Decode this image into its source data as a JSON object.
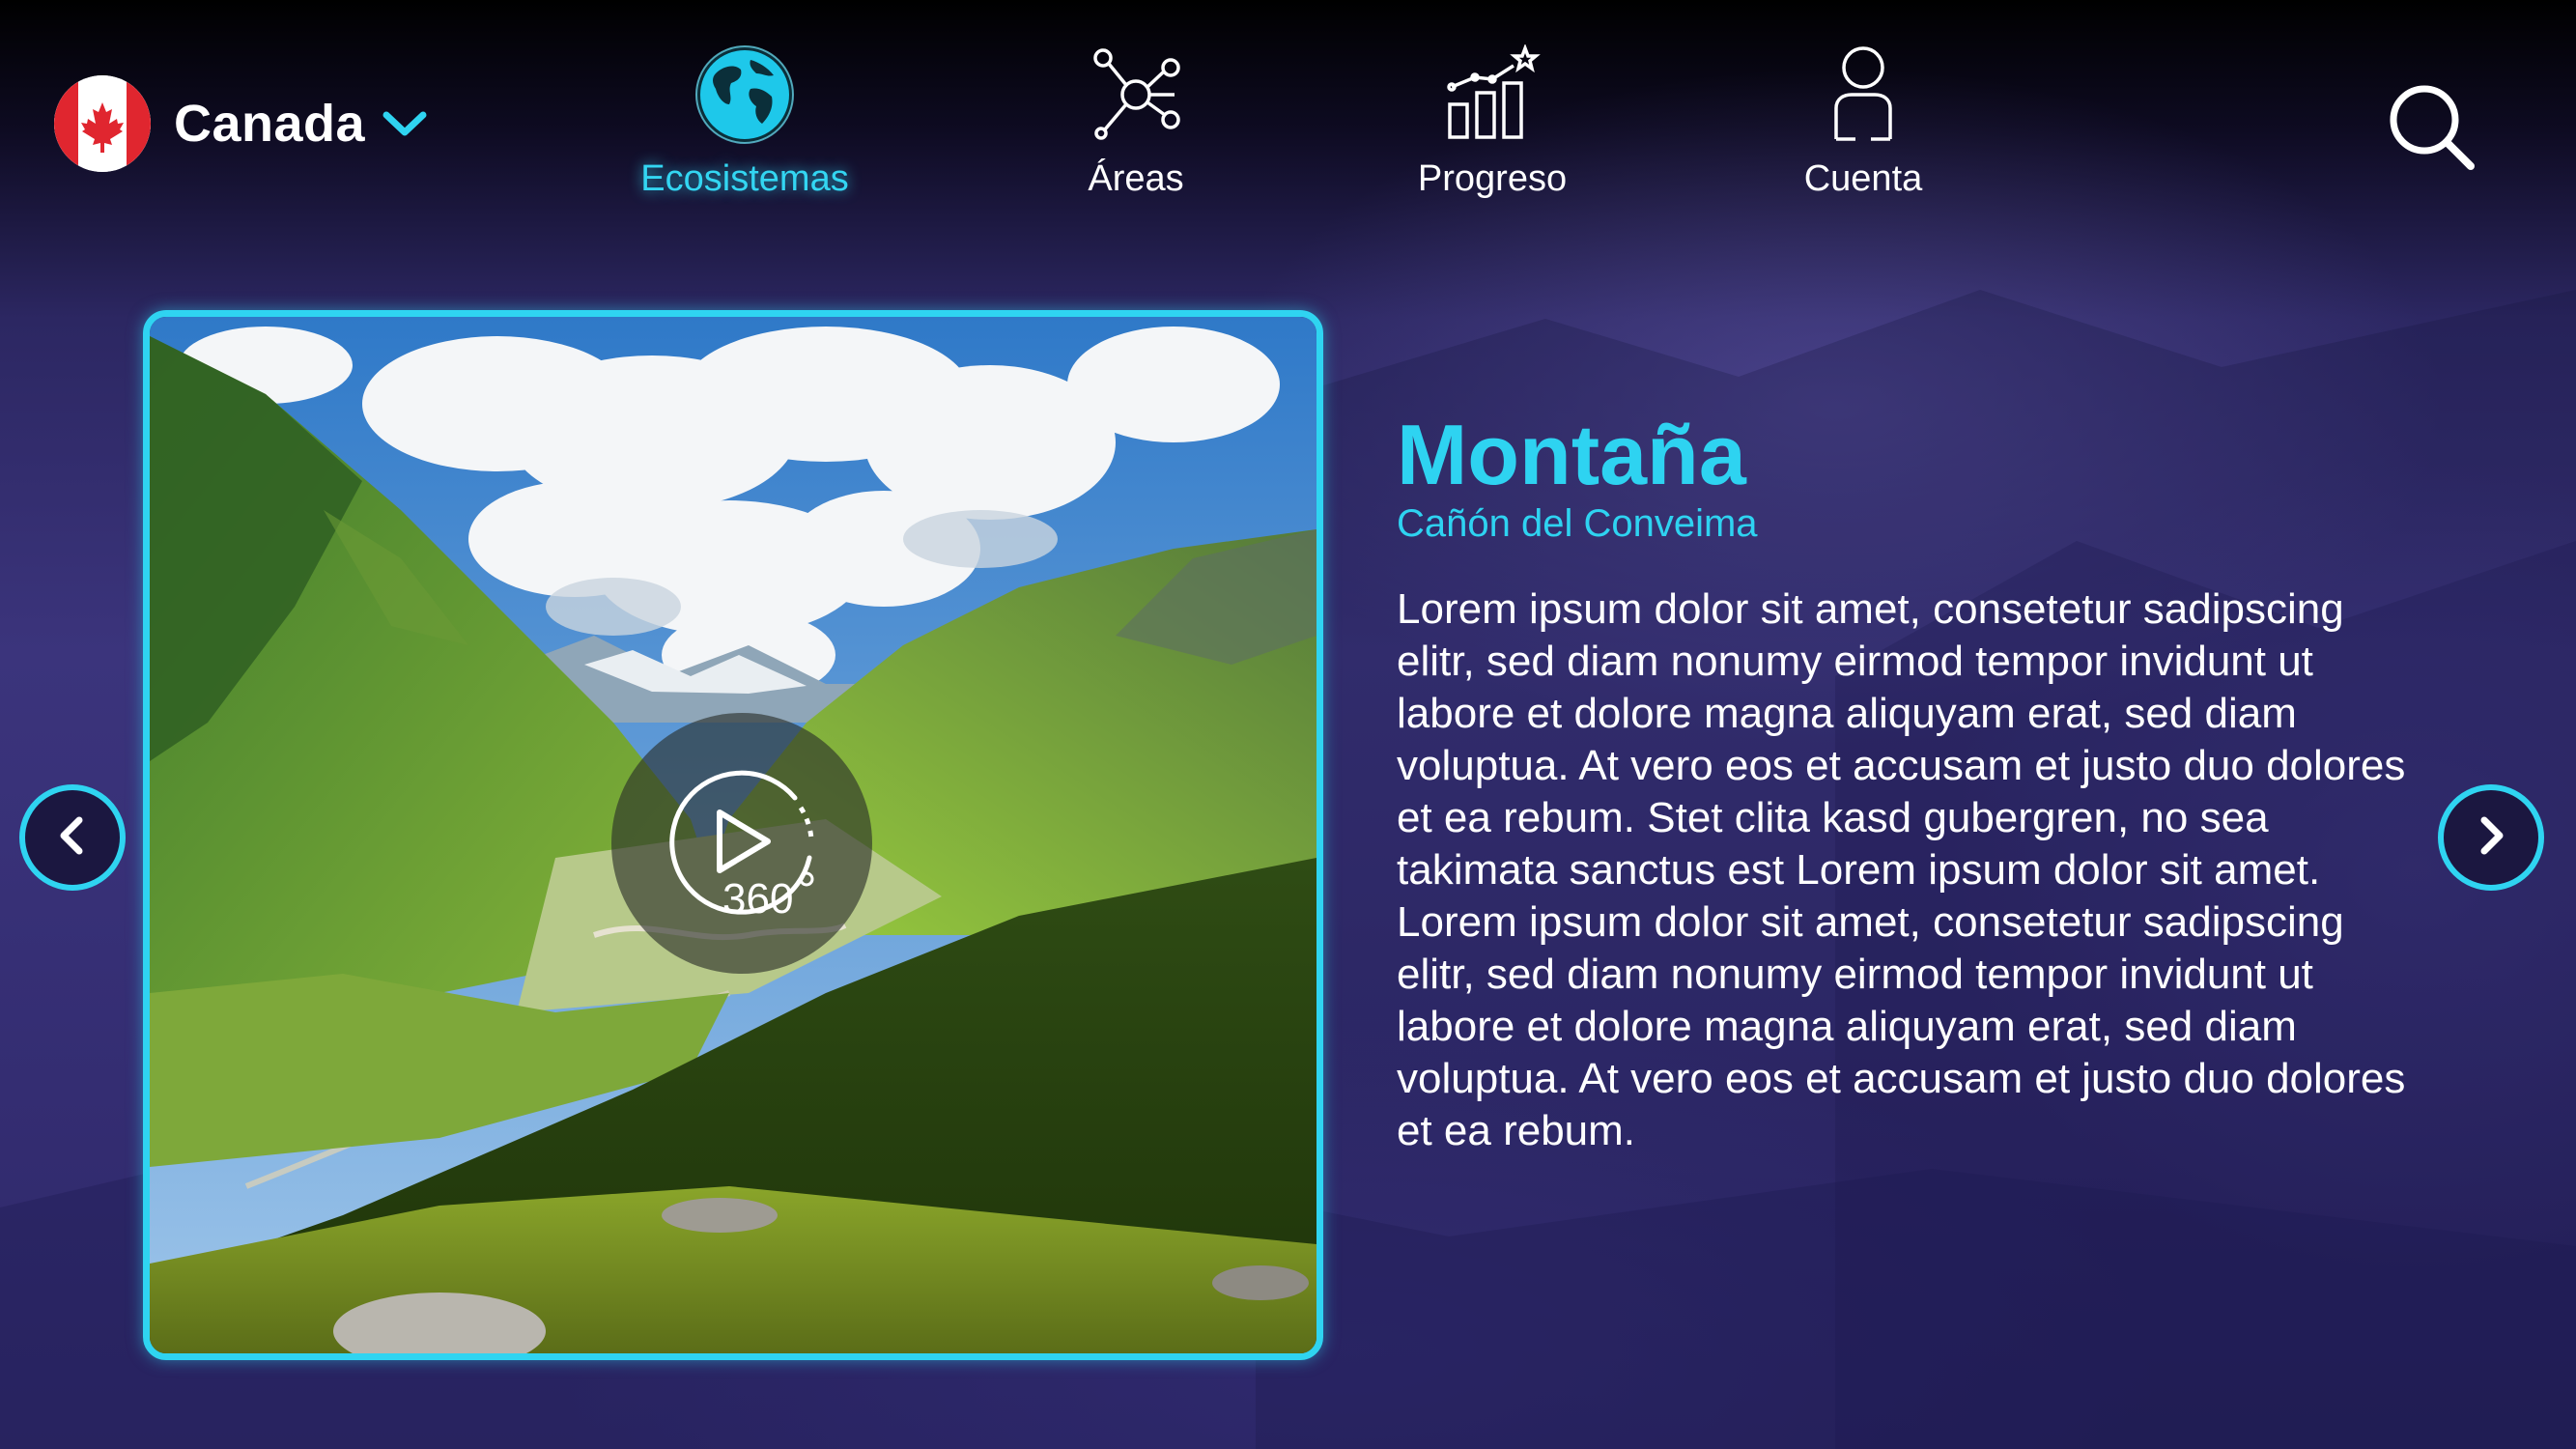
{
  "header": {
    "country": {
      "name": "Canada",
      "flag_icon": "canada-flag-icon",
      "dropdown_icon": "chevron-down-icon"
    },
    "nav": [
      {
        "id": "ecosistemas",
        "label": "Ecosistemas",
        "icon": "globe-icon",
        "active": true
      },
      {
        "id": "areas",
        "label": "Áreas",
        "icon": "network-icon",
        "active": false
      },
      {
        "id": "progreso",
        "label": "Progreso",
        "icon": "chart-star-icon",
        "active": false
      },
      {
        "id": "cuenta",
        "label": "Cuenta",
        "icon": "user-icon",
        "active": false
      }
    ],
    "search_icon": "search-icon"
  },
  "main": {
    "media": {
      "image": "mountain-valley-image",
      "badge_text": "360",
      "badge_icon": "play-360-icon"
    },
    "title": "Montaña",
    "subtitle": "Cañón del Conveima",
    "description": "Lorem ipsum dolor sit amet, consetetur sadipscing elitr, sed diam nonumy eirmod tempor invidunt ut labore et dolore magna aliquyam erat, sed diam voluptua. At vero eos et accusam et justo duo dolores et ea rebum. Stet clita kasd gubergren, no sea takimata sanctus est Lorem ipsum dolor sit amet. Lorem ipsum dolor sit amet, consetetur sadipscing elitr, sed diam nonumy eirmod tempor invidunt ut labore et dolore magna aliquyam erat, sed diam voluptua. At vero eos et accusam et justo duo dolores et ea rebum.",
    "prev_icon": "chevron-left-icon",
    "next_icon": "chevron-right-icon"
  },
  "colors": {
    "accent": "#2fd4f1",
    "background": "#342d72",
    "text": "#ffffff"
  }
}
